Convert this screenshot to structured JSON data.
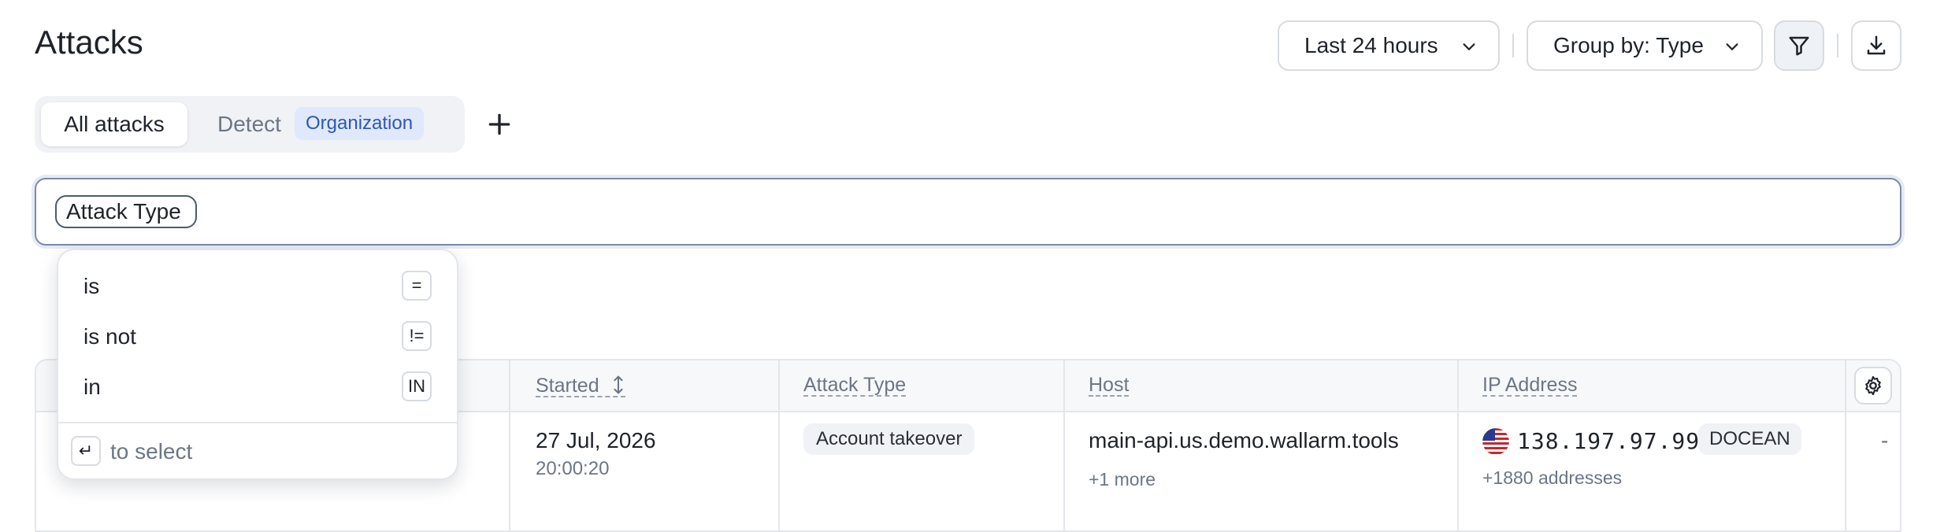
{
  "page": {
    "title": "Attacks"
  },
  "toolbar": {
    "time_range": "Last 24 hours",
    "group_by": "Group by: Type",
    "filter_icon": "filter-icon",
    "download_icon": "download-icon"
  },
  "tabs": {
    "items": [
      {
        "label": "All attacks",
        "active": true
      },
      {
        "label": "Detect",
        "badge": "Organization",
        "active": false
      }
    ],
    "add_icon": "plus-icon"
  },
  "search": {
    "chip": "Attack Type"
  },
  "operator_menu": {
    "options": [
      {
        "label": "is",
        "key": "="
      },
      {
        "label": "is not",
        "key": "!="
      },
      {
        "label": "in",
        "key": "IN"
      }
    ],
    "hint_key": "↵",
    "hint_text": "to select"
  },
  "table": {
    "columns": [
      "Started",
      "Attack Type",
      "Host",
      "IP Address"
    ],
    "settings_icon": "gear-icon",
    "rows": [
      {
        "started_date": "27 Jul, 2026",
        "started_time": "20:00:20",
        "attack_type": "Account takeover",
        "host": "main-api.us.demo.wallarm.tools",
        "host_more": "+1 more",
        "ip_flag": "us-flag-icon",
        "ip": "138.197.97.99",
        "ip_asn": "DOCEAN",
        "ip_more": "+1880 addresses",
        "extra": "-"
      }
    ]
  },
  "colors": {
    "accent_badge_bg": "#dfe9fb",
    "accent_badge_text": "#2f56b8",
    "border": "#d7dbe1"
  }
}
